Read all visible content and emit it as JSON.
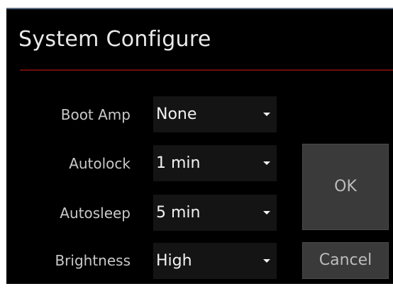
{
  "dialog": {
    "title": "System Configure"
  },
  "settings": [
    {
      "label": "Boot Amp",
      "value": "None"
    },
    {
      "label": "Autolock",
      "value": "1 min"
    },
    {
      "label": "Autosleep",
      "value": "5 min"
    },
    {
      "label": "Brightness",
      "value": "High"
    }
  ],
  "buttons": {
    "ok": "OK",
    "cancel": "Cancel"
  },
  "colors": {
    "background": "#000000",
    "title_rule": "#6e0c0c",
    "select_bg": "#141414",
    "button_bg": "#3a3a3a"
  },
  "icons": {
    "select_arrow": "chevron-down-icon"
  }
}
